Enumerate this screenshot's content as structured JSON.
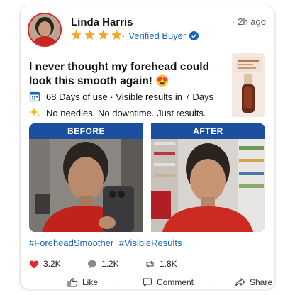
{
  "post": {
    "author": "Linda Harris",
    "time": "2h ago",
    "rating": 4,
    "verified_label": "Verified Buyer",
    "headline": "I never thought my forehead could look this smooth again!",
    "headline_emoji": "😍",
    "feature_1": "68 Days of use · Visible results in 7 Days",
    "feature_2": "No needles. No downtime. Just results.",
    "before_label": "BEFORE",
    "after_label": "AFTER",
    "hashtag_1": "#ForeheadSmoother",
    "hashtag_2": "#VisibleResults"
  },
  "stats": {
    "likes": "3.2K",
    "comments": "1.2K",
    "shares": "1.8K"
  },
  "actions": {
    "like": "Like",
    "comment": "Comment",
    "share": "Share"
  },
  "colors": {
    "accent_blue": "#1565c0",
    "label_bg": "#1c4fa0",
    "star": "#f5a623",
    "heart": "#e0282e"
  }
}
